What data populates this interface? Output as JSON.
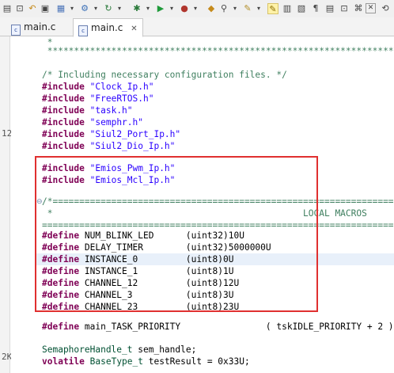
{
  "tabs": [
    {
      "label": "main.c",
      "active": false
    },
    {
      "label": "main.c",
      "active": true,
      "close": "✕"
    }
  ],
  "toolbar_icons": [
    "new-file",
    "save",
    "undo",
    "redo",
    "build",
    "debug",
    "run",
    "external-tools",
    "search",
    "edit",
    "highlight",
    "sidebar",
    "pin",
    "back",
    "forward"
  ],
  "left_fragments": {
    "a": "12",
    "b": "2K"
  },
  "lines": [
    {
      "text": " *"
    },
    {
      "text": " *************************************************************************"
    },
    {
      "text": ""
    },
    {
      "text": "/* Including necessary configuration files. */"
    },
    {
      "text": "#include \"Clock_Ip.h\""
    },
    {
      "text": "#include \"FreeRTOS.h\""
    },
    {
      "text": "#include \"task.h\""
    },
    {
      "text": "#include \"semphr.h\""
    },
    {
      "text": "#include \"Siul2_Port_Ip.h\""
    },
    {
      "text": "#include \"Siul2_Dio_Ip.h\""
    },
    {
      "text": ""
    },
    {
      "text": "#include \"Emios_Pwm_Ip.h\""
    },
    {
      "text": "#include \"Emios_Mcl_Ip.h\""
    },
    {
      "text": ""
    },
    {
      "text": "/*========================================================================"
    },
    {
      "text": " *                                               LOCAL MACROS"
    },
    {
      "text": "=========================================================================*/"
    },
    {
      "text": "#define NUM_BLINK_LED      (uint32)10U"
    },
    {
      "text": "#define DELAY_TIMER        (uint32)5000000U"
    },
    {
      "text": "#define INSTANCE_0         (uint8)0U"
    },
    {
      "text": "#define INSTANCE_1         (uint8)1U"
    },
    {
      "text": "#define CHANNEL_12         (uint8)12U"
    },
    {
      "text": "#define CHANNEL_3          (uint8)3U"
    },
    {
      "text": "#define CHANNEL_23         (uint8)23U"
    },
    {
      "text": ""
    },
    {
      "text": "#define main_TASK_PRIORITY                ( tskIDLE_PRIORITY + 2 )"
    },
    {
      "text": ""
    },
    {
      "text": "SemaphoreHandle_t sem_handle;"
    },
    {
      "text": "volatile BaseType_t testResult = 0x33U;"
    }
  ]
}
